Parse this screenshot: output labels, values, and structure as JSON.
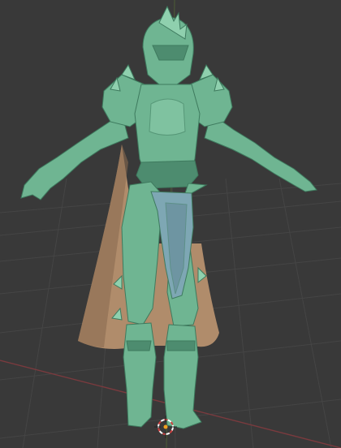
{
  "viewport": {
    "background": "#393939",
    "grid_color": "#454545",
    "x_axis_color": "#7a3a3e",
    "y_axis_color": "#5e7a33"
  },
  "model": {
    "armor_color": "#6fb592",
    "armor_shadow": "#4d8c6f",
    "armor_highlight": "#8fd0ae",
    "cape_color": "#b08c6b",
    "cape_shadow": "#8a6a50",
    "skirt_color": "#7ea7b4",
    "skirt_shadow": "#5f8592"
  },
  "gizmo": {
    "icon": "3d-cursor-icon",
    "ring_a": "#ffffff",
    "ring_b": "#d04040",
    "center_color": "#f0a020"
  }
}
